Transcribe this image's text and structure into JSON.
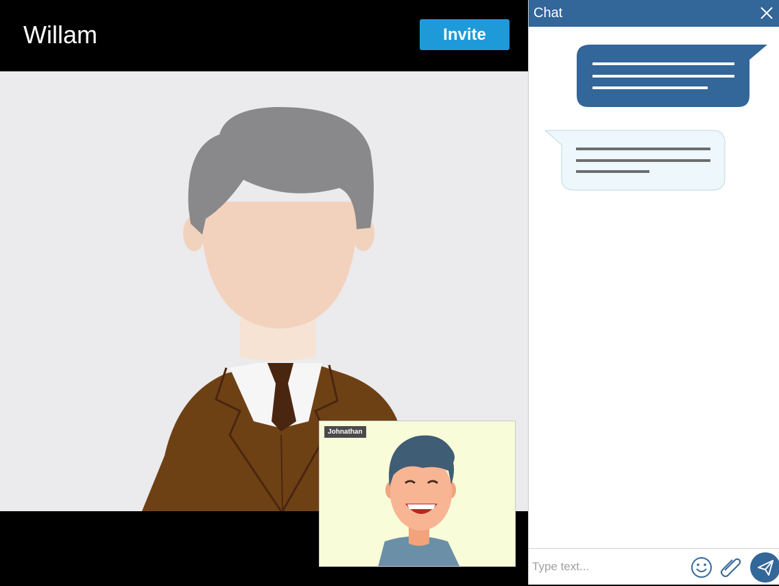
{
  "call": {
    "caller_name": "Willam",
    "invite_label": "Invite",
    "pip_label": "Johnathan"
  },
  "chat": {
    "title": "Chat",
    "input_placeholder": "Type text..."
  },
  "icons": {
    "close": "close-icon",
    "emoji": "smiley-icon",
    "attach": "paperclip-icon",
    "send": "paper-plane-icon"
  },
  "colors": {
    "chat_header": "#336699",
    "invite_button": "#1f9ad8",
    "outgoing_bubble": "#336699",
    "incoming_bubble": "#eef7fb"
  }
}
